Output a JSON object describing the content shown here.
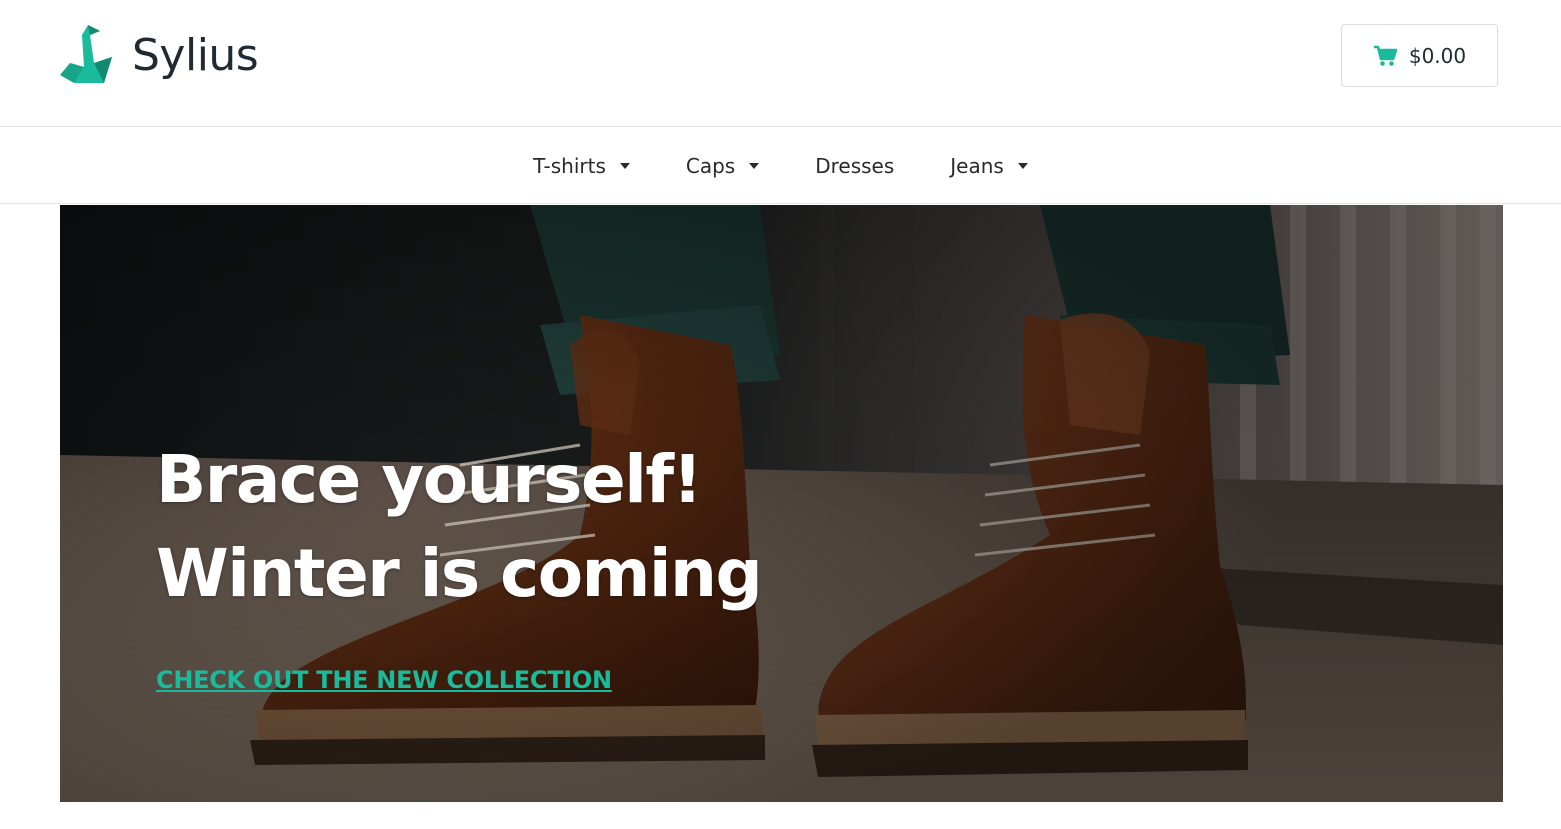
{
  "brand": {
    "name": "Sylius",
    "accent_color": "#1abb9c"
  },
  "cart": {
    "icon": "cart-icon",
    "total": "$0.00"
  },
  "nav": {
    "items": [
      {
        "label": "T-shirts",
        "has_dropdown": true
      },
      {
        "label": "Caps",
        "has_dropdown": true
      },
      {
        "label": "Dresses",
        "has_dropdown": false
      },
      {
        "label": "Jeans",
        "has_dropdown": true
      }
    ]
  },
  "hero": {
    "headline_line1": "Brace yourself!",
    "headline_line2": "Winter is coming",
    "cta": "CHECK OUT THE NEW COLLECTION",
    "image": "brown-leather-boots-photo"
  }
}
